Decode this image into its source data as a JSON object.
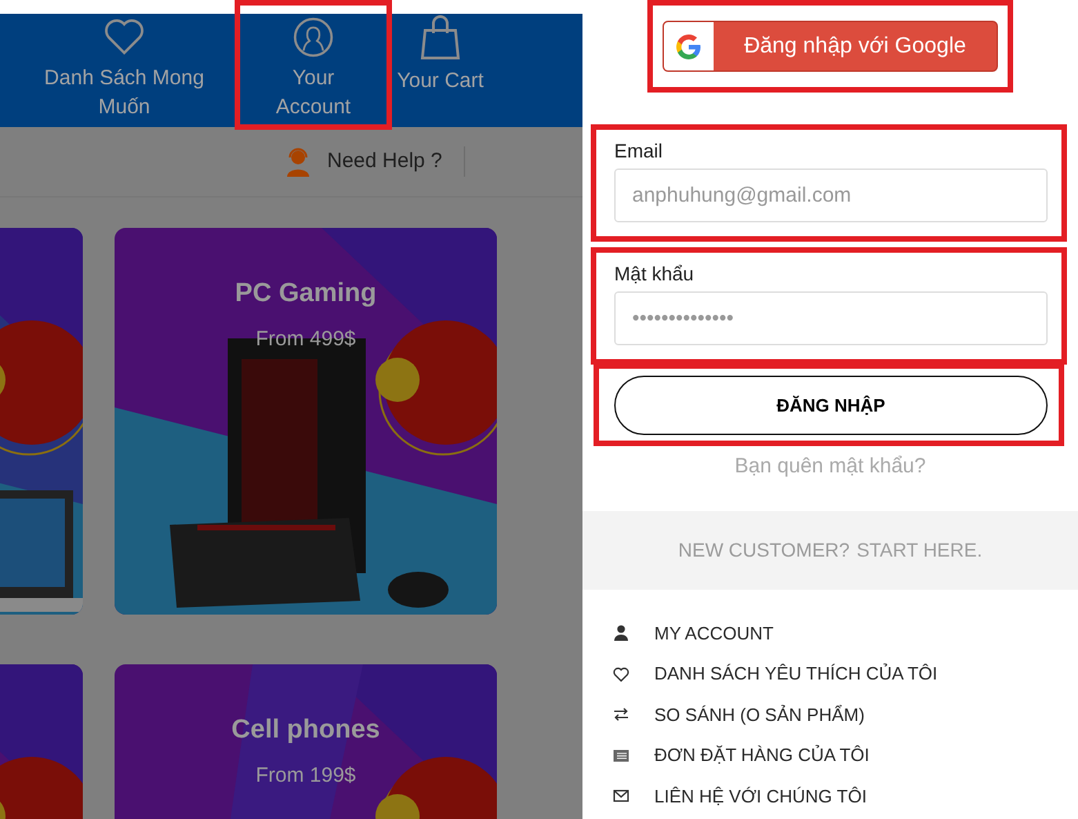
{
  "header": {
    "nav_items": [
      {
        "label": "Danh Sách Mong Muốn",
        "highlighted": false
      },
      {
        "label": "Your Account",
        "highlighted": true
      },
      {
        "label": "Your Cart",
        "highlighted": false
      }
    ],
    "help_link": "Need Help ?"
  },
  "banners": [
    {
      "kind": "picture"
    },
    {
      "kind": "picture",
      "title": "PC Gaming",
      "price": "From 499$"
    },
    {
      "kind": "picture"
    },
    {
      "kind": "picture",
      "title": "Cell phones",
      "price": "From 199$"
    }
  ],
  "login": {
    "google_button": {
      "label": "Đăng nhập với Google",
      "highlighted": true
    },
    "fields": [
      {
        "label": "Email",
        "placeholder": "anphuhung@gmail.com",
        "highlighted": true
      },
      {
        "label": "Mật khẩu",
        "placeholder": "••••••••••••••",
        "highlighted": true
      }
    ],
    "submit_button": {
      "label": "ĐĂNG NHẬP",
      "highlighted": true
    },
    "forgot_link": "Bạn quên mật khẩu?"
  },
  "new_customer": {
    "text": "NEW CUSTOMER?",
    "link": "START HERE."
  },
  "account_menu": [
    {
      "label": "MY ACCOUNT"
    },
    {
      "label": "DANH SÁCH YÊU THÍCH CỦA TÔI"
    },
    {
      "label": "SO SÁNH (O SẢN PHẨM)"
    },
    {
      "label": "ĐƠN ĐẶT HÀNG CỦA TÔI"
    },
    {
      "label": "LIÊN HỆ VỚI CHÚNG TÔI"
    }
  ]
}
